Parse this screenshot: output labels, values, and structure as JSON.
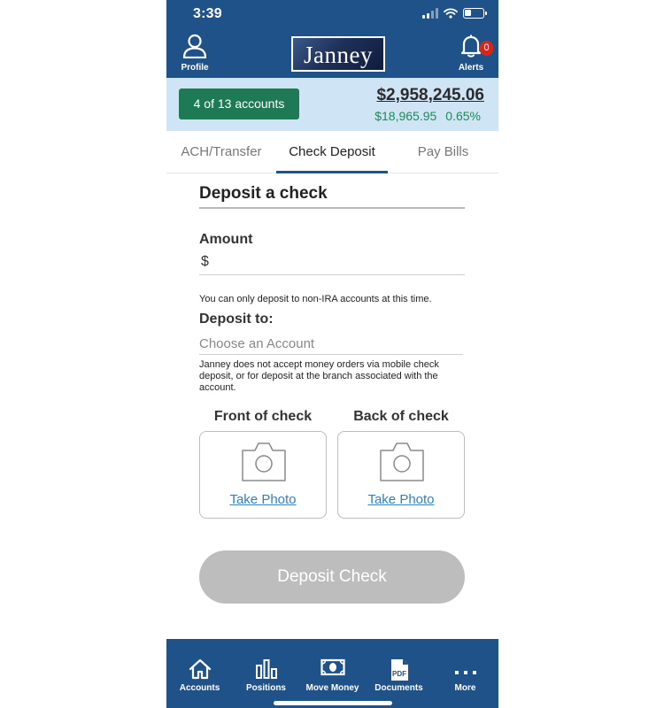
{
  "status_bar": {
    "time": "3:39"
  },
  "header": {
    "profile_label": "Profile",
    "logo_text": "Janney",
    "alerts_label": "Alerts",
    "alerts_count": "0"
  },
  "summary": {
    "accounts_label": "4 of 13 accounts",
    "balance": "$2,958,245.06",
    "change_amount": "$18,965.95",
    "change_percent": "0.65%"
  },
  "tabs": [
    {
      "label": "ACH/Transfer",
      "active": false
    },
    {
      "label": "Check Deposit",
      "active": true
    },
    {
      "label": "Pay Bills",
      "active": false
    }
  ],
  "form": {
    "title": "Deposit a check",
    "amount_label": "Amount",
    "currency_symbol": "$",
    "amount_value": "",
    "ira_note": "You can only deposit to non-IRA accounts at this time.",
    "deposit_to_label": "Deposit to:",
    "account_placeholder": "Choose an Account",
    "money_order_note": "Janney does not accept money orders via mobile check deposit, or for deposit at the branch associated with the account.",
    "front_label": "Front of check",
    "back_label": "Back of check",
    "take_photo_label": "Take Photo",
    "submit_label": "Deposit Check",
    "submit_enabled": false
  },
  "bottom_nav": [
    {
      "label": "Accounts",
      "icon": "home-icon"
    },
    {
      "label": "Positions",
      "icon": "bar-chart-icon"
    },
    {
      "label": "Move Money",
      "icon": "money-icon"
    },
    {
      "label": "Documents",
      "icon": "pdf-document-icon",
      "icon_text": "PDF"
    },
    {
      "label": "More",
      "icon": "more-dots-icon"
    }
  ],
  "colors": {
    "brand_blue": "#20528a",
    "summary_bg": "#cfe5f6",
    "accent_green": "#1d7a55",
    "link_blue": "#2a82c6",
    "disabled_gray": "#bdbdbd",
    "badge_red": "#d9261c"
  }
}
